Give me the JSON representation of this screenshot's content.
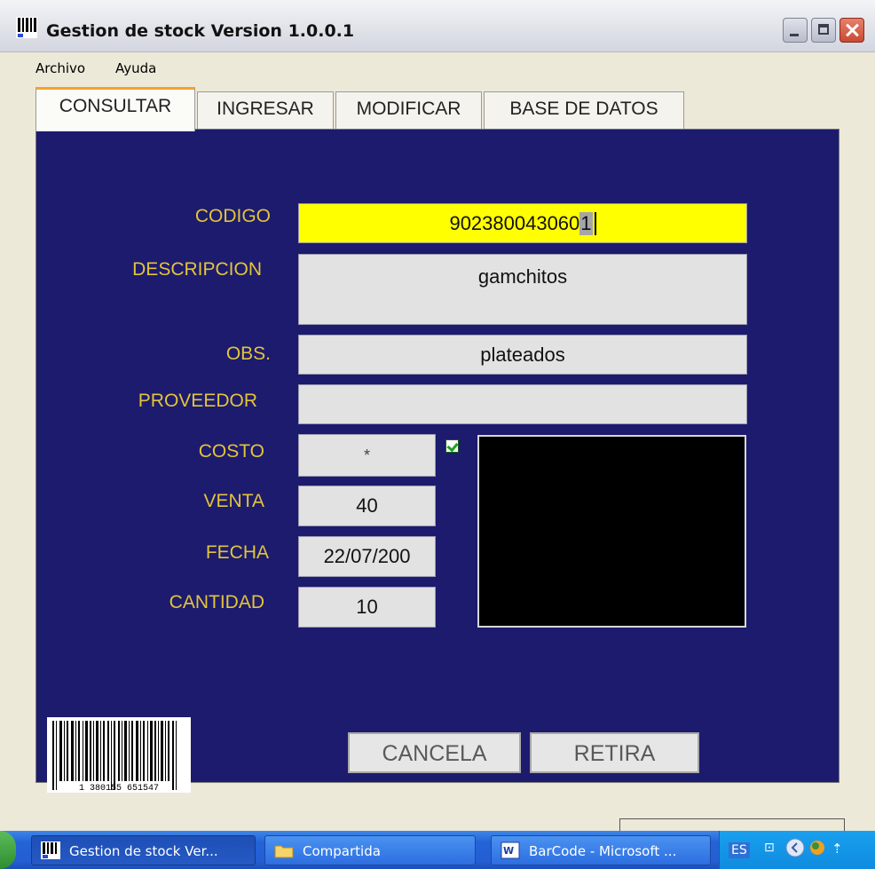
{
  "window": {
    "title": "Gestion de stock Version 1.0.0.1",
    "icon": "barcode-icon"
  },
  "menu": {
    "items": [
      "Archivo",
      "Ayuda"
    ]
  },
  "tabs": [
    {
      "label": "CONSULTAR",
      "active": true
    },
    {
      "label": "INGRESAR",
      "active": false
    },
    {
      "label": "MODIFICAR",
      "active": false
    },
    {
      "label": "BASE DE DATOS",
      "active": false
    }
  ],
  "form": {
    "codigo": {
      "label": "CODIGO",
      "value_main": "902380043060",
      "value_selected": "1"
    },
    "descripcion": {
      "label": "DESCRIPCION",
      "value": "gamchitos"
    },
    "obs": {
      "label": "OBS.",
      "value": "plateados"
    },
    "proveedor": {
      "label": "PROVEEDOR",
      "value": ""
    },
    "costo": {
      "label": "COSTO",
      "value": "*"
    },
    "venta": {
      "label": "VENTA",
      "value": "40"
    },
    "fecha": {
      "label": "FECHA",
      "value": "22/07/200"
    },
    "cantidad": {
      "label": "CANTIDAD",
      "value": "10"
    },
    "show_cost_checked": true
  },
  "barcode_digits": "1 380155 651547",
  "buttons": {
    "cancel": "CANCELA",
    "withdraw": "RETIRA"
  },
  "taskbar": {
    "tasks": [
      {
        "label": "Gestion de stock Ver...",
        "icon": "barcode-icon"
      },
      {
        "label": "Compartida",
        "icon": "folder-icon"
      },
      {
        "label": "BarCode - Microsoft ...",
        "icon": "word-icon"
      }
    ],
    "language": "ES"
  },
  "colors": {
    "panel_bg": "#1c1b6e",
    "label": "#e3c43a",
    "codigo_field": "#ffff00",
    "field": "#e2e2e2"
  }
}
